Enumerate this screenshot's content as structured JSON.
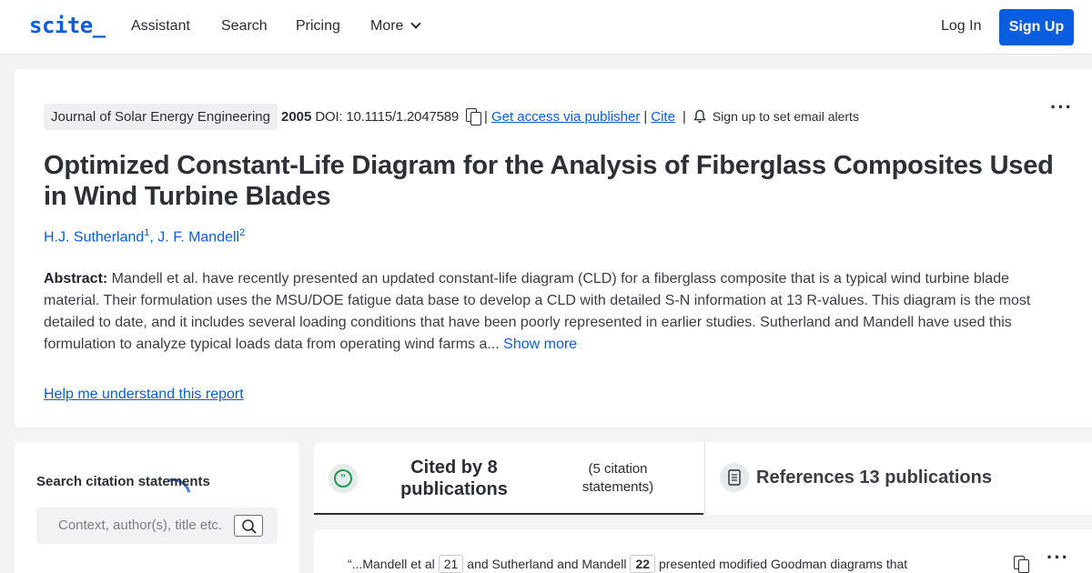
{
  "nav": {
    "logo": "scite_",
    "items": [
      "Assistant",
      "Search",
      "Pricing",
      "More"
    ],
    "login": "Log In",
    "signup": "Sign Up"
  },
  "paper": {
    "journal": "Journal of Solar Energy Engineering",
    "year": "2005",
    "doi": "DOI: 10.1115/1.2047589",
    "access_link": "Get access via publisher",
    "cite_link": "Cite",
    "alerts": "Sign up to set email alerts",
    "title": "Optimized Constant-Life Diagram for the Analysis of Fiberglass Composites Used in Wind Turbine Blades",
    "authors": [
      {
        "name": "H.J. Sutherland",
        "sup": "1"
      },
      {
        "name": "J. F. Mandell",
        "sup": "2"
      }
    ],
    "abstract_label": "Abstract:",
    "abstract_text": " Mandell et al. have recently presented an updated constant-life diagram (CLD) for a fiberglass composite that is a typical wind turbine blade material. Their formulation uses the MSU/DOE fatigue data base to develop a CLD with detailed S-N information at 13 R-values. This diagram is the most detailed to date, and it includes several loading conditions that have been poorly represented in earlier studies. Sutherland and Mandell have used this formulation to analyze typical loads data from operating wind farms a...",
    "show_more": "Show more",
    "help_link": "Help me understand this report"
  },
  "search": {
    "label": "Search citation statements",
    "placeholder": "Context, author(s), title etc."
  },
  "tabs": {
    "cited_by": "Cited by 8 publications",
    "citation_statements": "(5 citation statements)",
    "references": "References 13 publications"
  },
  "snippet": {
    "text1": "“...Mandell et al",
    "ref1": "21",
    "text2": "and Sutherland and Mandell",
    "ref2": "22",
    "text3": "presented modified Goodman diagrams that"
  },
  "colors": {
    "brand": "#0b5de0",
    "cited_icon": "#1a9d4b"
  }
}
